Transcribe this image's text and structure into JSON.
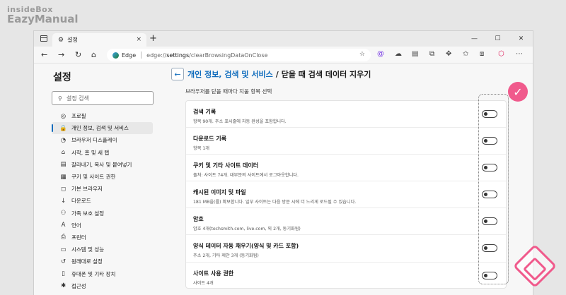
{
  "watermark": {
    "line1": "insideBox",
    "line2": "EazyManual"
  },
  "tab": {
    "title": "설정",
    "close": "×",
    "new": "+"
  },
  "window_controls": [
    "—",
    "☐",
    "✕"
  ],
  "address": {
    "site": "Edge",
    "url_scheme": "edge://",
    "url_path": "settings",
    "url_rest": "/clearBrowsingDataOnClose"
  },
  "sidebar": {
    "title": "설정",
    "search_placeholder": "설정 검색",
    "items": [
      {
        "label": "프로필",
        "icon": "profile-icon",
        "glyph": "◎"
      },
      {
        "label": "개인 정보, 검색 및 서비스",
        "icon": "lock-icon",
        "glyph": "🔒"
      },
      {
        "label": "브라우저 디스플레이",
        "icon": "palette-icon",
        "glyph": "◔"
      },
      {
        "label": "시작, 홈 및 새 탭",
        "icon": "home-icon",
        "glyph": "⌂"
      },
      {
        "label": "잘라내기, 복사 및 붙여넣기",
        "icon": "clipboard-icon",
        "glyph": "▤"
      },
      {
        "label": "쿠키 및 사이트 권한",
        "icon": "cookie-icon",
        "glyph": "▦"
      },
      {
        "label": "기본 브라우저",
        "icon": "browser-icon",
        "glyph": "◻"
      },
      {
        "label": "다운로드",
        "icon": "download-icon",
        "glyph": "↓"
      },
      {
        "label": "가족 보호 설정",
        "icon": "family-icon",
        "glyph": "⚇"
      },
      {
        "label": "언어",
        "icon": "language-icon",
        "glyph": "A"
      },
      {
        "label": "프린터",
        "icon": "printer-icon",
        "glyph": "⎙"
      },
      {
        "label": "시스템 및 성능",
        "icon": "system-icon",
        "glyph": "▭"
      },
      {
        "label": "원래대로 설정",
        "icon": "reset-icon",
        "glyph": "↺"
      },
      {
        "label": "휴대폰 및 기타 장치",
        "icon": "phone-icon",
        "glyph": "▯"
      },
      {
        "label": "접근성",
        "icon": "accessibility-icon",
        "glyph": "✱"
      }
    ]
  },
  "main": {
    "breadcrumb": "개인 정보, 검색 및 서비스",
    "separator": "/",
    "page_title": "닫을 때 검색 데이터 지우기",
    "subtitle": "브라우저를 닫을 때마다 지울 항목 선택",
    "rows": [
      {
        "title": "검색 기록",
        "desc": "항목 90개. 주소 표시줄에 자동 완성을 포함합니다."
      },
      {
        "title": "다운로드 기록",
        "desc": "항목 1개"
      },
      {
        "title": "쿠키 및 기타 사이트 데이터",
        "desc": "출처: 사이트 74개. 대부분의 사이트에서 로그아웃합니다."
      },
      {
        "title": "캐시된 이미지 및 파일",
        "desc": "181 MB을(를) 확보합니다. 일부 사이트는 다음 방문 시에 더 느리게 로드될 수 있습니다."
      },
      {
        "title": "암호",
        "desc": "암호 4개(techsmith.com, live.com, 외 2개, 동기화됨)"
      },
      {
        "title": "양식 데이터 자동 채우기(양식 및 카드 포함)",
        "desc": "주소 2개, 기타 제안 3개 (동기화됨)"
      },
      {
        "title": "사이트 사용 권한",
        "desc": "사이트 4개"
      }
    ]
  }
}
